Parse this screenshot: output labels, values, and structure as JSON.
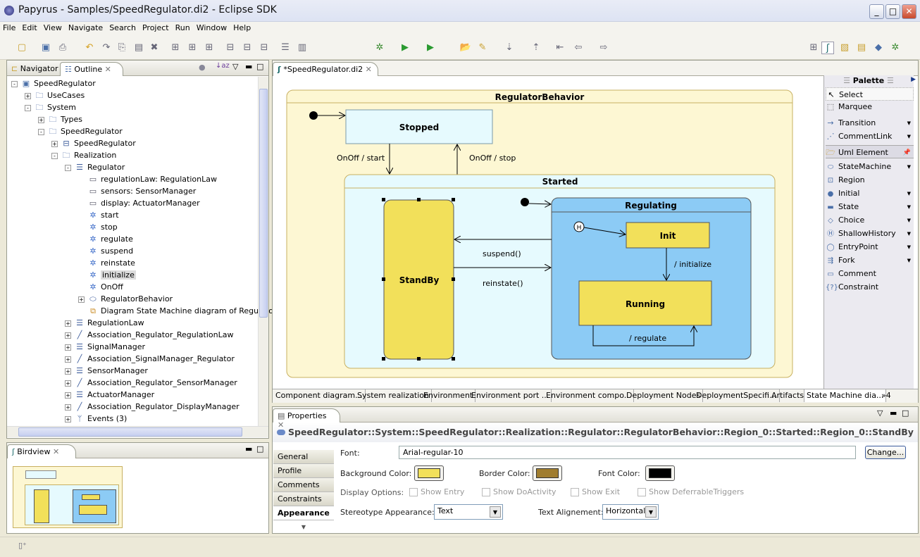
{
  "window": {
    "title": "Papyrus - Samples/SpeedRegulator.di2 - Eclipse SDK"
  },
  "menu": [
    "File",
    "Edit",
    "View",
    "Navigate",
    "Search",
    "Project",
    "Run",
    "Window",
    "Help"
  ],
  "left_tabs": {
    "navigator": "Navigator",
    "outline": "Outline"
  },
  "tree": [
    {
      "label": "SpeedRegulator",
      "level": 0,
      "icon": "package-icon",
      "exp": "-"
    },
    {
      "label": "UseCases",
      "level": 1,
      "icon": "folder-icon",
      "exp": "+"
    },
    {
      "label": "System",
      "level": 1,
      "icon": "folder-icon",
      "exp": "-"
    },
    {
      "label": "Types",
      "level": 2,
      "icon": "folder-icon",
      "exp": "+"
    },
    {
      "label": "SpeedRegulator",
      "level": 2,
      "icon": "folder-icon",
      "exp": "-"
    },
    {
      "label": "SpeedRegulator",
      "level": 3,
      "icon": "component-icon",
      "exp": "+"
    },
    {
      "label": "Realization",
      "level": 3,
      "icon": "folder-icon",
      "exp": "-"
    },
    {
      "label": "Regulator",
      "level": 4,
      "icon": "class-icon",
      "exp": "-"
    },
    {
      "label": "regulationLaw: RegulationLaw",
      "level": 5,
      "icon": "property-icon"
    },
    {
      "label": "sensors: SensorManager",
      "level": 5,
      "icon": "property-icon"
    },
    {
      "label": "display: ActuatorManager",
      "level": 5,
      "icon": "property-icon"
    },
    {
      "label": "start",
      "level": 5,
      "icon": "operation-icon"
    },
    {
      "label": "stop",
      "level": 5,
      "icon": "operation-icon"
    },
    {
      "label": "regulate",
      "level": 5,
      "icon": "operation-icon"
    },
    {
      "label": "suspend",
      "level": 5,
      "icon": "operation-icon"
    },
    {
      "label": "reinstate",
      "level": 5,
      "icon": "operation-icon"
    },
    {
      "label": "initialize",
      "level": 5,
      "icon": "operation-icon",
      "selected": true
    },
    {
      "label": "OnOff",
      "level": 5,
      "icon": "operation-icon"
    },
    {
      "label": "RegulatorBehavior",
      "level": 5,
      "icon": "statemachine-icon",
      "exp": "+"
    },
    {
      "label": "Diagram State Machine diagram of Regulator",
      "level": 5,
      "icon": "diagram-icon"
    },
    {
      "label": "RegulationLaw",
      "level": 4,
      "icon": "class-icon",
      "exp": "+"
    },
    {
      "label": "Association_Regulator_RegulationLaw",
      "level": 4,
      "icon": "association-icon",
      "exp": "+"
    },
    {
      "label": "SignalManager",
      "level": 4,
      "icon": "class-icon",
      "exp": "+"
    },
    {
      "label": "Association_SignalManager_Regulator",
      "level": 4,
      "icon": "association-icon",
      "exp": "+"
    },
    {
      "label": "SensorManager",
      "level": 4,
      "icon": "class-icon",
      "exp": "+"
    },
    {
      "label": "Association_Regulator_SensorManager",
      "level": 4,
      "icon": "association-icon",
      "exp": "+"
    },
    {
      "label": "ActuatorManager",
      "level": 4,
      "icon": "class-icon",
      "exp": "+"
    },
    {
      "label": "Association_Regulator_DisplayManager",
      "level": 4,
      "icon": "association-icon",
      "exp": "+"
    },
    {
      "label": "Events (3)",
      "level": 4,
      "icon": "events-icon",
      "exp": "+"
    }
  ],
  "birdview": {
    "title": "Birdview"
  },
  "editor": {
    "tab": "*SpeedRegulator.di2"
  },
  "diagram": {
    "machine": "RegulatorBehavior",
    "stopped": "Stopped",
    "started": "Started",
    "standby": "StandBy",
    "regulating": "Regulating",
    "init": "Init",
    "running": "Running",
    "history": "H",
    "t_start": "OnOff / start",
    "t_stop": "OnOff / stop",
    "t_suspend": "suspend()",
    "t_reinstate": "reinstate()",
    "t_initialize": "/ initialize",
    "t_regulate": "/ regulate"
  },
  "palette": {
    "title": "Palette",
    "tools": [
      "Select",
      "Marquee",
      "Transition",
      "CommentLink"
    ],
    "drawer": "Uml Element",
    "items": [
      "StateMachine",
      "Region",
      "Initial",
      "State",
      "Choice",
      "ShallowHistory",
      "EntryPoint",
      "Fork",
      "Comment",
      "Constraint"
    ]
  },
  "diagram_tabs": [
    "Component diagram...",
    "System realization",
    "Environment",
    "Environment port ...",
    "Environment compo...",
    "Deployment Nodes",
    "DeploymentSpecifi...",
    "Artifacts",
    "State Machine dia..."
  ],
  "diagram_tabs_more": "»4",
  "properties": {
    "tab": "Properties",
    "path": "SpeedRegulator::System::SpeedRegulator::Realization::Regulator::RegulatorBehavior::Region_0::Started::Region_0::StandBy",
    "sections": [
      "General",
      "Profile",
      "Comments",
      "Constraints",
      "Appearance"
    ],
    "selected_section": "Appearance",
    "font_label": "Font:",
    "font_value": "Arial-regular-10",
    "change_button": "Change...",
    "bg_label": "Background Color:",
    "border_label": "Border Color:",
    "fontcolor_label": "Font Color:",
    "colors": {
      "background": "#f2e05a",
      "border": "#a07d2e",
      "font": "#000000"
    },
    "display_label": "Display Options:",
    "options": [
      "Show Entry",
      "Show DoActivity",
      "Show Exit",
      "Show DeferrableTriggers"
    ],
    "stereo_label": "Stereotype Appearance:",
    "stereo_value": "Text",
    "align_label": "Text Alignement:",
    "align_value": "Horizontal"
  }
}
